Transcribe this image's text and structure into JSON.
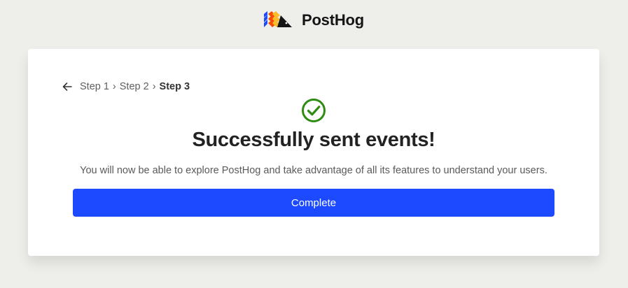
{
  "brand": {
    "name": "PostHog",
    "logo_icon": "posthog-hedgehog-logo"
  },
  "breadcrumb": {
    "back_icon": "arrow-left-icon",
    "steps": [
      "Step 1",
      "Step 2",
      "Step 3"
    ],
    "separator": "›"
  },
  "status": {
    "icon": "check-circle-icon",
    "color": "#2e8b12",
    "title": "Successfully sent events!",
    "description": "You will now be able to explore PostHog and take advantage of all its features to understand your users."
  },
  "actions": {
    "complete_label": "Complete",
    "primary_color": "#1d4aff"
  }
}
